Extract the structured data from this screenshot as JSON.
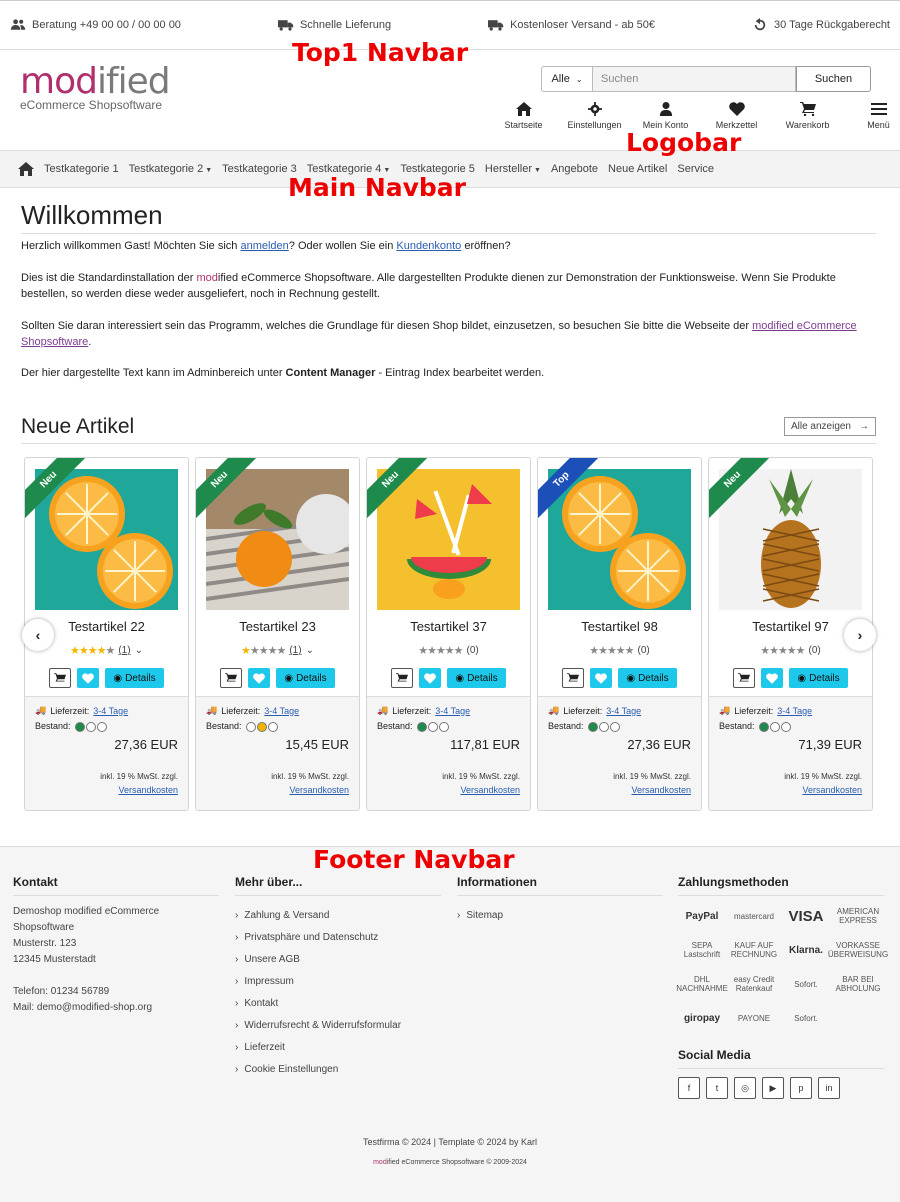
{
  "topbar": {
    "items": [
      {
        "label": "Beratung +49 00 00 / 00 00 00",
        "icon": "users-icon"
      },
      {
        "label": "Schnelle Lieferung",
        "icon": "truck-icon"
      },
      {
        "label": "Kostenloser Versand - ab 50€",
        "icon": "truck-icon"
      },
      {
        "label": "30 Tage Rückgaberecht",
        "icon": "undo-icon"
      }
    ]
  },
  "annotations": {
    "top1": "Top1 Navbar",
    "logobar": "Logobar",
    "main": "Main Navbar",
    "footer": "Footer Navbar"
  },
  "logo": {
    "word_prefix": "mod",
    "word_suffix": "ified",
    "sub": "eCommerce Shopsoftware"
  },
  "search": {
    "category": "Alle",
    "placeholder": "Suchen",
    "button": "Suchen"
  },
  "iconnav": [
    {
      "label": "Startseite",
      "icon": "home-icon"
    },
    {
      "label": "Einstellungen",
      "icon": "gear-icon"
    },
    {
      "label": "Mein Konto",
      "icon": "user-icon"
    },
    {
      "label": "Merkzettel",
      "icon": "heart-icon"
    },
    {
      "label": "Warenkorb",
      "icon": "cart-icon"
    },
    {
      "label": "Menü",
      "icon": "menu-icon"
    }
  ],
  "mainnav": [
    {
      "label": "Testkategorie 1",
      "dropdown": false
    },
    {
      "label": "Testkategorie 2",
      "dropdown": true
    },
    {
      "label": "Testkategorie 3",
      "dropdown": false
    },
    {
      "label": "Testkategorie 4",
      "dropdown": true
    },
    {
      "label": "Testkategorie 5",
      "dropdown": false
    },
    {
      "label": "Hersteller",
      "dropdown": true
    },
    {
      "label": "Angebote",
      "dropdown": false
    },
    {
      "label": "Neue Artikel",
      "dropdown": false
    },
    {
      "label": "Service",
      "dropdown": false
    }
  ],
  "welcome": {
    "title": "Willkommen",
    "p1_a": "Herzlich willkommen Gast! Möchten Sie sich ",
    "p1_link1": "anmelden",
    "p1_b": "? Oder wollen Sie ein ",
    "p1_link2": "Kundenkonto",
    "p1_c": " eröffnen?",
    "p2_a": "Dies ist die Standardinstallation der ",
    "p2_mod": "mod",
    "p2_ified": "ified",
    "p2_b": " eCommerce Shopsoftware. Alle dargestellten Produkte dienen zur Demonstration der Funktionsweise. Wenn Sie Produkte bestellen, so werden diese weder ausgeliefert, noch in Rechnung gestellt.",
    "p3_a": "Sollten Sie daran interessiert sein das Programm, welches die Grundlage für diesen Shop bildet, einzusetzen, so besuchen Sie bitte die Webseite der ",
    "p3_link": "modified eCommerce Shopsoftware",
    "p3_b": ".",
    "p4_a": "Der hier dargestellte Text kann im Adminbereich unter ",
    "p4_bold": "Content Manager",
    "p4_b": " - Eintrag Index bearbeitet werden."
  },
  "neue": {
    "title": "Neue Artikel",
    "all_label": "Alle anzeigen"
  },
  "products": [
    {
      "name": "Testartikel 22",
      "ribbon": "Neu",
      "ribbon_color": "#1e8a4c",
      "rating": 4,
      "reviews": "(1)",
      "has_chevron": true,
      "stock": [
        1,
        0,
        0
      ],
      "price": "27,36 EUR",
      "image": "orange-half"
    },
    {
      "name": "Testartikel 23",
      "ribbon": "Neu",
      "ribbon_color": "#1e8a4c",
      "rating": 1,
      "reviews": "(1)",
      "has_chevron": true,
      "stock": [
        0,
        2,
        0
      ],
      "price": "15,45 EUR",
      "image": "mandarin"
    },
    {
      "name": "Testartikel 37",
      "ribbon": "Neu",
      "ribbon_color": "#1e8a4c",
      "rating": 0,
      "reviews": "(0)",
      "has_chevron": false,
      "stock": [
        1,
        0,
        0
      ],
      "price": "117,81 EUR",
      "image": "watermelon"
    },
    {
      "name": "Testartikel 98",
      "ribbon": "Top",
      "ribbon_color": "#1d4fb8",
      "rating": 0,
      "reviews": "(0)",
      "has_chevron": false,
      "stock": [
        1,
        0,
        0
      ],
      "price": "27,36 EUR",
      "image": "orange-half"
    },
    {
      "name": "Testartikel 97",
      "ribbon": "Neu",
      "ribbon_color": "#1e8a4c",
      "rating": 0,
      "reviews": "(0)",
      "has_chevron": false,
      "stock": [
        1,
        0,
        0
      ],
      "price": "71,39 EUR",
      "image": "pineapple"
    }
  ],
  "product_labels": {
    "details": "Details",
    "lieferzeit": "Lieferzeit:",
    "lieferzeit_value": "3-4 Tage",
    "bestand": "Bestand:",
    "tax": "inkl. 19 % MwSt. zzgl.",
    "ship": "Versandkosten"
  },
  "footer": {
    "kontakt_title": "Kontakt",
    "kontakt_lines": [
      "Demoshop modified eCommerce",
      "Shopsoftware",
      "Musterstr. 123",
      "12345 Musterstadt",
      "",
      "Telefon: 01234 56789",
      "Mail: demo@modified-shop.org"
    ],
    "mehr_title": "Mehr über...",
    "mehr_links": [
      "Zahlung & Versand",
      "Privatsphäre und Datenschutz",
      "Unsere AGB",
      "Impressum",
      "Kontakt",
      "Widerrufsrecht & Widerrufsformular",
      "Lieferzeit",
      "Cookie Einstellungen"
    ],
    "info_title": "Informationen",
    "info_links": [
      "Sitemap"
    ],
    "pay_title": "Zahlungsmethoden",
    "pay_methods": [
      "PayPal",
      "mastercard",
      "VISA",
      "AMERICAN EXPRESS",
      "SEPA Lastschrift",
      "KAUF AUF RECHNUNG",
      "Klarna.",
      "VORKASSE ÜBERWEISUNG",
      "DHL NACHNAHME",
      "easy Credit Ratenkauf",
      "Sofort.",
      "BAR BEI ABHOLUNG",
      "giropay",
      "PAYONE",
      "Sofort."
    ],
    "social_title": "Social Media",
    "social": [
      "facebook-icon",
      "twitter-icon",
      "instagram-icon",
      "youtube-icon",
      "pinterest-icon",
      "linkedin-icon"
    ],
    "copyright": "Testfirma © 2024 | Template © 2024 by Karl",
    "copy2_mod": "mod",
    "copy2_rest": "ified eCommerce Shopsoftware © 2009-2024"
  },
  "colors": {
    "brand": "#b0306e",
    "details_button": "#1ec8ea",
    "stock_green": "#1e8a4c",
    "stock_yellow": "#f0b400",
    "star": "#f5b400"
  }
}
